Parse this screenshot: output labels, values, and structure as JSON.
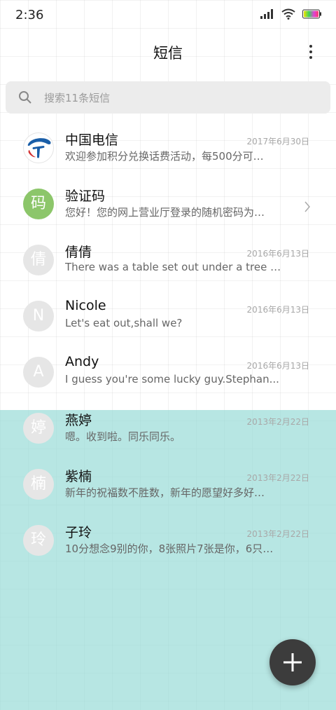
{
  "status_bar": {
    "time": "2:36"
  },
  "header": {
    "title": "短信"
  },
  "search": {
    "placeholder": "搜索11条短信"
  },
  "conversations": [
    {
      "name": "中国电信",
      "date": "2017年6月30日",
      "snippet": "欢迎参加积分兑换话费活动，每500分可…",
      "avatar_type": "china-telecom-logo"
    },
    {
      "name": "验证码",
      "date": "",
      "snippet": "您好！您的网上营业厅登录的随机密码为…",
      "avatar_char": "码",
      "avatar_color": "#8cc66a"
    },
    {
      "name": "倩倩",
      "date": "2016年6月13日",
      "snippet": "There was a table set out under a tree i...",
      "avatar_char": "倩"
    },
    {
      "name": "Nicole",
      "date": "2016年6月13日",
      "snippet": "Let's eat out,shall we?",
      "avatar_char": "N"
    },
    {
      "name": "Andy",
      "date": "2016年6月13日",
      "snippet": "I guess you're some lucky guy.Stephan...",
      "avatar_char": "A"
    },
    {
      "name": "燕婷",
      "date": "2013年2月22日",
      "snippet": "嗯。收到啦。同乐同乐。",
      "avatar_char": "婷"
    },
    {
      "name": "紫楠",
      "date": "2013年2月22日",
      "snippet": "新年的祝福数不胜数，新年的愿望好多好…",
      "avatar_char": "楠"
    },
    {
      "name": "子玲",
      "date": "2013年2月22日",
      "snippet": "10分想念9别的你，8张照片7张是你，6只…",
      "avatar_char": "玲"
    }
  ],
  "colors": {
    "accent_green": "#8cc66a",
    "fab": "#3c3c3c",
    "overlay_teal": "#98dcd7"
  },
  "fab": {
    "icon": "plus-icon"
  }
}
